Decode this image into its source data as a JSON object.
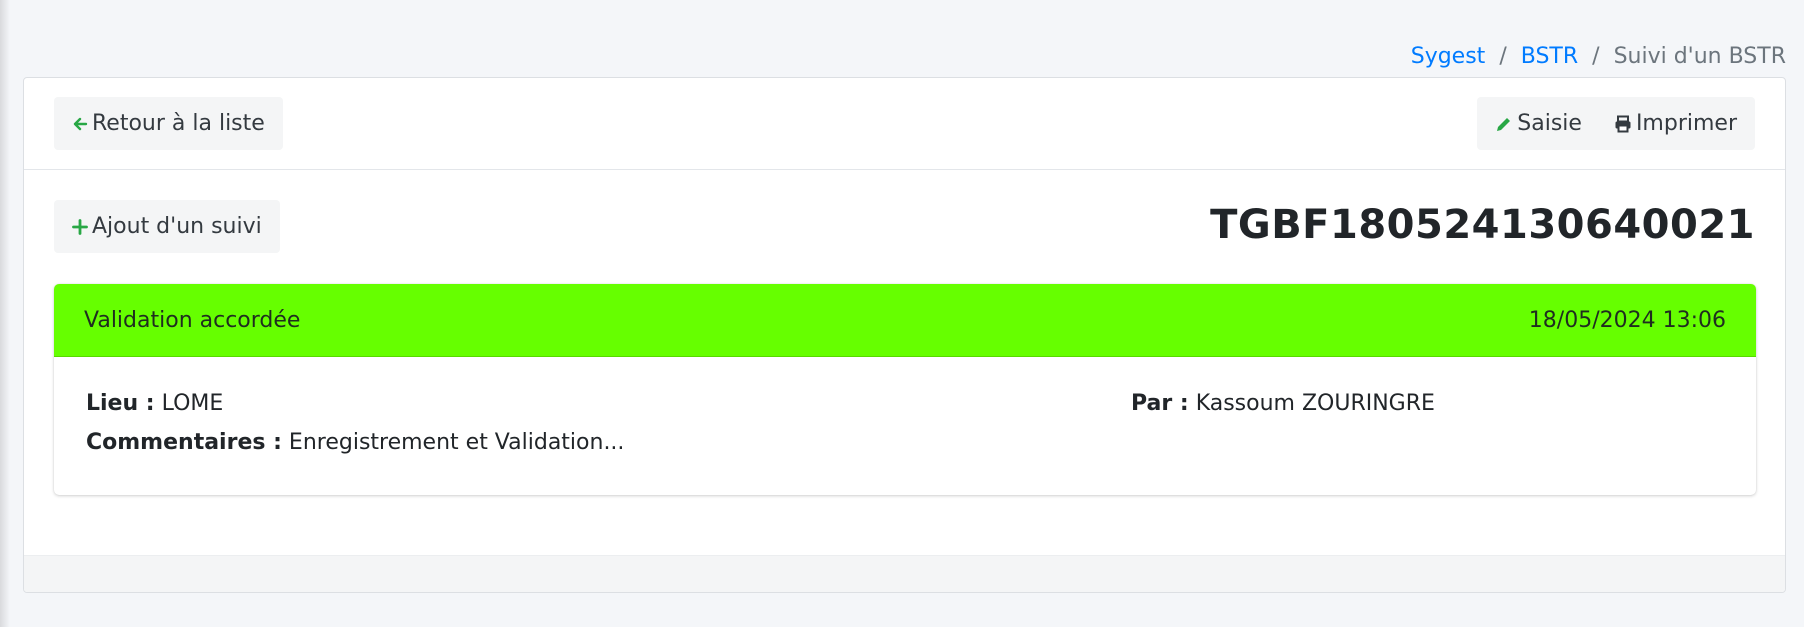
{
  "breadcrumb": {
    "items": [
      "Sygest",
      "BSTR",
      "Suivi d'un BSTR"
    ],
    "separator": "/"
  },
  "header": {
    "back_label": "Retour à la liste",
    "saisie_label": "Saisie",
    "imprimer_label": "Imprimer"
  },
  "body": {
    "add_label": "Ajout d'un suivi",
    "tracking_number": "TGBF180524130640021"
  },
  "event": {
    "status": "Validation accordée",
    "datetime": "18/05/2024 13:06",
    "lieu_label": "Lieu :",
    "lieu_value": "LOME",
    "par_label": "Par :",
    "par_value": "Kassoum ZOURINGRE",
    "comment_label": "Commentaires :",
    "comment_value": "Enregistrement et Validation..."
  },
  "colors": {
    "status_green": "#66ff00",
    "icon_green": "#28a745",
    "link_blue": "#007bff"
  },
  "icons": {
    "back": "arrow-left-icon",
    "saisie": "pencil-icon",
    "imprimer": "printer-icon",
    "add": "plus-icon"
  }
}
